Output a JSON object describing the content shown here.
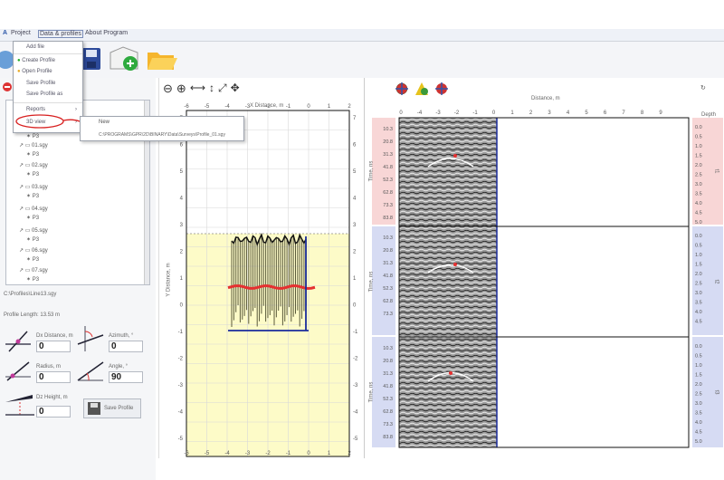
{
  "menubar": {
    "logo": "A",
    "project": "Project",
    "data_profiles": "Data & profiles",
    "about": "About Program"
  },
  "menu": {
    "items": [
      "Add file",
      "Create Profile",
      "Open Profile",
      "Save Profile",
      "Save Profile as",
      "Reports",
      "3D view"
    ]
  },
  "submenu": {
    "items": [
      "New",
      "C:\\PROGRAMS\\GPR\\2D\\BINARY\\Data\\Surveys\\Profile_01.sgy"
    ]
  },
  "tree": {
    "rows": [
      "P3",
      "P3",
      "P3",
      "P3",
      "P3",
      "P3",
      "P3",
      "P3"
    ]
  },
  "left": {
    "path_label": "C:\\Profiles\\Line13.sgy",
    "profile_length": "Profile Length: 13.53 m",
    "dx_label": "Dx Distance, m",
    "dx_value": "0",
    "azimuth_label": "Azimuth, °",
    "azimuth_value": "0",
    "radius_label": "Radius, m",
    "radius_value": "0",
    "angle_label": "Angle, °",
    "angle_value": "90",
    "dz_label": "Dz Height, m",
    "dz_value": "0",
    "save_label": "Save Profile"
  },
  "mid": {
    "top_axis_title": "X Distance, m",
    "side_axis_title": "Y Distance, m",
    "x_ticks": [
      "-6",
      "-5",
      "-4",
      "-3",
      "-2",
      "-1",
      "0",
      "1",
      "2"
    ],
    "y_ticks": [
      "7",
      "6",
      "5",
      "4",
      "3",
      "2",
      "1",
      "0",
      "-1",
      "-2",
      "-3",
      "-4",
      "-5"
    ]
  },
  "right": {
    "top_axis_title": "Distance, m",
    "x_ticks": [
      "0",
      "-4",
      "-3",
      "-2",
      "-1",
      "0",
      "1",
      "2",
      "3",
      "4",
      "5",
      "6",
      "7",
      "8",
      "9"
    ],
    "depth_title": "Depth",
    "panels": [
      {
        "side_label": "Time, ns",
        "right_label": "t1",
        "left_ticks": [
          "10.3",
          "20.8",
          "31.3",
          "41.8",
          "52.3",
          "62.8",
          "73.3",
          "83.8"
        ],
        "right_ticks": [
          "0.0",
          "0.5",
          "1.0",
          "1.5",
          "2.0",
          "2.5",
          "3.0",
          "3.5",
          "4.0",
          "4.5",
          "5.0"
        ]
      },
      {
        "side_label": "Time, ns",
        "right_label": "t2",
        "left_ticks": [
          "10.3",
          "20.8",
          "31.3",
          "41.8",
          "52.3",
          "62.8",
          "73.3"
        ],
        "right_ticks": [
          "0.0",
          "0.5",
          "1.0",
          "1.5",
          "2.0",
          "2.5",
          "3.0",
          "3.5",
          "4.0",
          "4.5"
        ]
      },
      {
        "side_label": "Time, ns",
        "right_label": "t3",
        "left_ticks": [
          "10.3",
          "20.8",
          "31.3",
          "41.8",
          "52.3",
          "62.8",
          "73.3",
          "83.8"
        ],
        "right_ticks": [
          "0.0",
          "0.5",
          "1.0",
          "1.5",
          "2.0",
          "2.5",
          "3.0",
          "3.5",
          "4.0",
          "4.5",
          "5.0"
        ]
      }
    ]
  },
  "colors": {
    "menubar": "#eef1f7",
    "plot_fill": "#fdfbc8",
    "profile_line": "#1a2b9c",
    "red_track": "#e53030",
    "pink_band": "#f8d6d6",
    "blue_band": "#d6dbf3"
  },
  "icons": [
    "cd-icon",
    "save-icon",
    "add-folder-icon",
    "open-folder-icon",
    "zoom-out-icon",
    "zoom-in-icon",
    "fit-width-icon",
    "fit-height-icon",
    "fit-all-icon",
    "move-icon",
    "crosshair-icon",
    "triangle-icon",
    "target-icon"
  ]
}
